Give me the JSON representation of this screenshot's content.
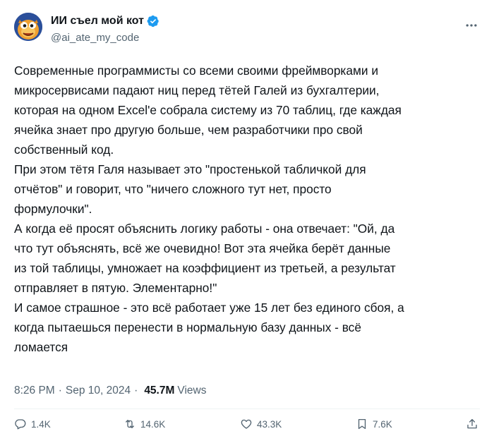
{
  "author": {
    "display_name": "ИИ съел мой кот",
    "handle": "@ai_ate_my_code",
    "verified": true,
    "avatar_icon": "cartoon-creature-avatar"
  },
  "tweet": {
    "text": "Современные программисты со всеми своими фреймворками и\nмикросервисами падают ниц перед тётей Галей из бухгалтерии,\nкоторая на одном Excel'е собрала систему из 70 таблиц, где каждая\nячейка знает про другую больше, чем разработчики про свой\nсобственный код.\nПри этом тётя Галя называет это \"простенькой табличкой для\nотчётов\" и говорит, что \"ничего сложного тут нет, просто\nформулочки\".\nА когда её просят объяснить логику работы - она отвечает: \"Ой, да\nчто тут объяснять, всё же очевидно! Вот эта ячейка берёт данные\nиз той таблицы, умножает на коэффициент из третьей, а результат\nотправляет в пятую. Элементарно!\"\nИ самое страшное - это всё работает уже 15 лет без единого сбоя, а\nкогда пытаешься перенести в нормальную базу данных - всё\nломается"
  },
  "meta": {
    "time": "8:26 PM",
    "separator": "·",
    "date": "Sep 10, 2024",
    "views_count": "45.7M",
    "views_label": "Views"
  },
  "actions": {
    "reply_count": "1.4K",
    "retweet_count": "14.6K",
    "like_count": "43.3K",
    "bookmark_count": "7.6K"
  },
  "colors": {
    "text": "#0f1419",
    "secondary": "#536471",
    "verified": "#1d9bf0",
    "divider": "#eff3f4"
  }
}
